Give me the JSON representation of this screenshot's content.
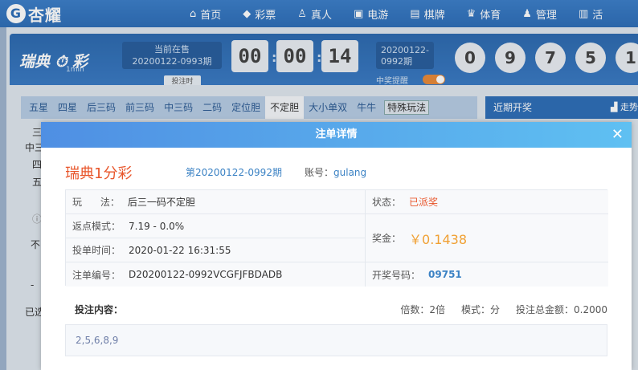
{
  "header": {
    "logo": "杏耀",
    "nav": [
      {
        "icon": "home-icon",
        "glyph": "⌂",
        "label": "首页"
      },
      {
        "icon": "diamond-icon",
        "glyph": "◆",
        "label": "彩票"
      },
      {
        "icon": "person-icon",
        "glyph": "♙",
        "label": "真人"
      },
      {
        "icon": "game-icon",
        "glyph": "▣",
        "label": "电游"
      },
      {
        "icon": "cards-icon",
        "glyph": "▤",
        "label": "棋牌"
      },
      {
        "icon": "trophy-icon",
        "glyph": "♛",
        "label": "体育"
      },
      {
        "icon": "users-icon",
        "glyph": "♟",
        "label": "管理"
      },
      {
        "icon": "gift-icon",
        "glyph": "▥",
        "label": "活"
      }
    ]
  },
  "lottery": {
    "name": "瑞典",
    "name_suffix": "彩",
    "sub": "1min",
    "current_label": "当前在售",
    "current_issue": "20200122-0993期",
    "countdown_btn": "投注时",
    "time": [
      "00",
      "00",
      "14"
    ],
    "last_issue_1": "20200122-",
    "last_issue_2": "0992期",
    "remind": "中奖提醒",
    "balls": [
      "0",
      "9",
      "7",
      "5",
      "1"
    ]
  },
  "tabs": [
    "五星",
    "四星",
    "后三码",
    "前三码",
    "中三码",
    "二码",
    "定位胆",
    "不定胆",
    "大小单双",
    "牛牛"
  ],
  "active_tab": "不定胆",
  "special_tab": "特殊玩法",
  "side": {
    "title": "近期开奖",
    "trend": "▟ 走势"
  },
  "modal": {
    "title": "注单详情",
    "close": "✕",
    "lottery_name": "瑞典1分彩",
    "issue": "第20200122-0992期",
    "account_label": "账号：",
    "account": "gulang",
    "play_label": "玩      法：",
    "play": "后三一码不定胆",
    "status_label": "状态：",
    "status": "已派奖",
    "rebate_label": "返点模式：",
    "rebate": "7.19 - 0.0%",
    "prize_label": "奖金：",
    "prize": "￥0.1438",
    "bet_time_label": "投单时间：",
    "bet_time": "2020-01-22 16:31:55",
    "order_label": "注单编号：",
    "order": "D20200122-0992VCGFJFBDADB",
    "draw_label": "开奖号码：",
    "draw": "09751",
    "content_label": "投注内容：",
    "multiple": "倍数：2倍",
    "mode": "模式：分",
    "total": "投注总金额：0.2000",
    "content": "2,5,6,8,9"
  },
  "background_left": [
    "三",
    "中三",
    "四",
    "五",
    "ⓘ",
    "不",
    "-",
    "已选"
  ]
}
